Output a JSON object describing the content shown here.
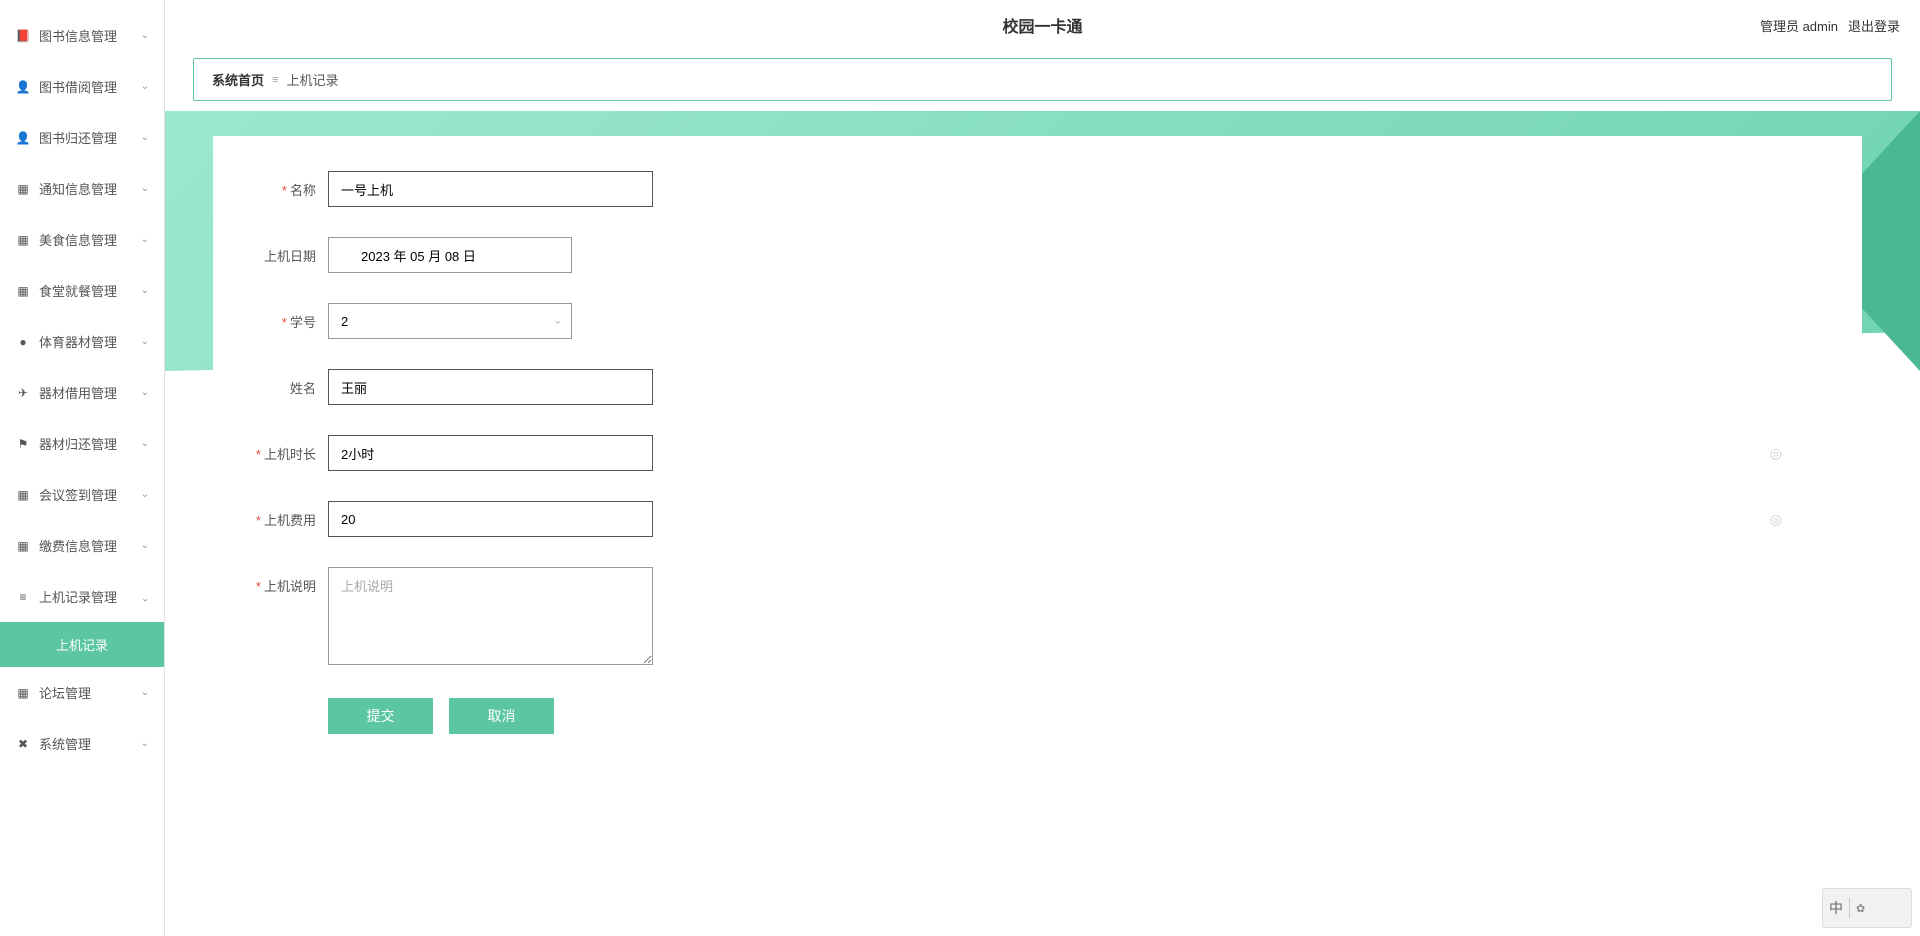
{
  "header": {
    "title": "校园一卡通",
    "admin_label": "管理员 admin",
    "logout_label": "退出登录"
  },
  "breadcrumb": {
    "home": "系统首页",
    "current": "上机记录"
  },
  "sidebar": {
    "items": [
      {
        "icon": "📕",
        "label": "图书信息管理"
      },
      {
        "icon": "👤",
        "label": "图书借阅管理"
      },
      {
        "icon": "👤",
        "label": "图书归还管理"
      },
      {
        "icon": "▦",
        "label": "通知信息管理"
      },
      {
        "icon": "▦",
        "label": "美食信息管理"
      },
      {
        "icon": "▦",
        "label": "食堂就餐管理"
      },
      {
        "icon": "●",
        "label": "体育器材管理"
      },
      {
        "icon": "✈",
        "label": "器材借用管理"
      },
      {
        "icon": "⚑",
        "label": "器材归还管理"
      },
      {
        "icon": "▦",
        "label": "会议签到管理"
      },
      {
        "icon": "▦",
        "label": "缴费信息管理"
      },
      {
        "icon": "≡",
        "label": "上机记录管理",
        "expanded": true,
        "children": [
          {
            "label": "上机记录",
            "active": true
          }
        ]
      },
      {
        "icon": "▦",
        "label": "论坛管理"
      },
      {
        "icon": "✖",
        "label": "系统管理"
      }
    ]
  },
  "form": {
    "name": {
      "label": "名称",
      "value": "一号上机",
      "required": true
    },
    "date": {
      "label": "上机日期",
      "value": "2023 年 05 月 08 日",
      "required": false
    },
    "student_id": {
      "label": "学号",
      "value": "2",
      "required": true
    },
    "student_name": {
      "label": "姓名",
      "value": "王丽",
      "required": false
    },
    "duration": {
      "label": "上机时长",
      "value": "2小时",
      "required": true
    },
    "fee": {
      "label": "上机费用",
      "value": "20",
      "required": true
    },
    "description": {
      "label": "上机说明",
      "value": "",
      "placeholder": "上机说明",
      "required": true
    },
    "submit_label": "提交",
    "cancel_label": "取消"
  },
  "ime": {
    "lang": "中"
  }
}
